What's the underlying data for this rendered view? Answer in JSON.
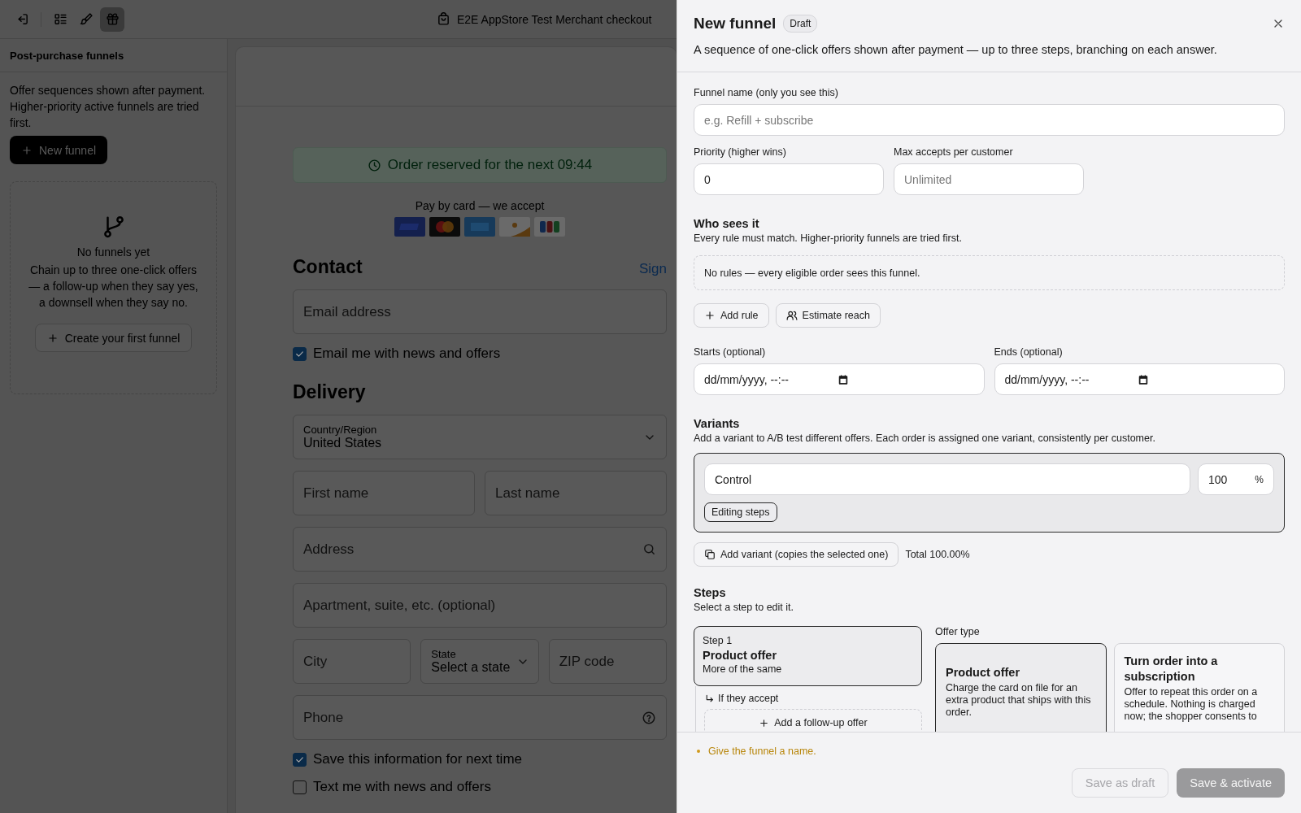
{
  "toolbar": {
    "items": [
      {
        "kind": "exit",
        "selected": false
      },
      {
        "kind": "list",
        "selected": false
      },
      {
        "kind": "brush",
        "selected": false
      },
      {
        "kind": "gift",
        "selected": true
      }
    ],
    "title": "E2E AppStore Test Merchant checkout"
  },
  "sidebar": {
    "heading": "Post-purchase funnels",
    "description": "Offer sequences shown after payment. Higher-priority active funnels are tried first.",
    "new_button": "New funnel",
    "empty": {
      "title": "No funnels yet",
      "text": "Chain up to three one-click offers — a follow-up when they say yes, a downsell when they say no.",
      "button": "Create your first funnel"
    }
  },
  "checkout": {
    "banner": "Order reserved for the next 09:44",
    "payment_note": "Pay by card — we accept",
    "cards": [
      {
        "kind": "visa"
      },
      {
        "kind": "mastercard"
      },
      {
        "kind": "amex"
      },
      {
        "kind": "discover"
      },
      {
        "kind": "jcb"
      }
    ],
    "contact": {
      "heading": "Contact",
      "link": "Sign",
      "email_placeholder": "Email address",
      "news": {
        "label": "Email me with news and offers",
        "checked": true
      }
    },
    "delivery": {
      "heading": "Delivery",
      "rows": [
        [
          {
            "kind": "select",
            "label": "Country/Region",
            "value": "United States"
          }
        ],
        [
          {
            "kind": "text",
            "placeholder": "First name"
          },
          {
            "kind": "text",
            "placeholder": "Last name"
          }
        ],
        [
          {
            "kind": "search",
            "placeholder": "Address"
          }
        ],
        [
          {
            "kind": "text",
            "placeholder": "Apartment, suite, etc. (optional)"
          }
        ],
        [
          {
            "kind": "text",
            "placeholder": "City"
          },
          {
            "kind": "select",
            "label": "State",
            "value": "Select a state"
          },
          {
            "kind": "text",
            "placeholder": "ZIP code"
          }
        ],
        [
          {
            "kind": "help",
            "placeholder": "Phone"
          }
        ]
      ],
      "options": [
        {
          "label": "Save this information for next time",
          "checked": true
        },
        {
          "label": "Text me with news and offers",
          "checked": false
        }
      ]
    }
  },
  "drawer": {
    "title": "New funnel",
    "badge": "Draft",
    "subtitle": "A sequence of one-click offers shown after payment — up to three steps, branching on each answer.",
    "name_field": {
      "label": "Funnel name (only you see this)",
      "placeholder": "e.g. Refill + subscribe"
    },
    "priority": {
      "label": "Priority (higher wins)",
      "value": "0"
    },
    "max_accepts": {
      "label": "Max accepts per customer",
      "placeholder": "Unlimited"
    },
    "audience": {
      "heading": "Who sees it",
      "text": "Every rule must match. Higher-priority funnels are tried first.",
      "empty": "No rules — every eligible order sees this funnel.",
      "buttons": [
        {
          "kind": "add",
          "label": "Add rule"
        },
        {
          "kind": "people",
          "label": "Estimate reach"
        }
      ]
    },
    "schedule": [
      {
        "label": "Starts (optional)",
        "value": "dd/mm/yyyy, --:--"
      },
      {
        "label": "Ends (optional)",
        "value": "dd/mm/yyyy, --:--"
      }
    ],
    "variants": {
      "heading": "Variants",
      "text": "Add a variant to A/B test different offers. Each order is assigned one variant, consistently per customer.",
      "items": [
        {
          "name": "Control",
          "weight": "100",
          "unit": "%",
          "status": "Editing steps",
          "selected": true
        }
      ],
      "add_button": "Add variant (copies the selected one)",
      "total": "Total 100.00%"
    },
    "steps": {
      "heading": "Steps",
      "text": "Select a step to edit it.",
      "items": [
        {
          "number": "Step 1",
          "title": "Product offer",
          "subtitle": "More of the same",
          "selected": true,
          "branch": "If they accept",
          "add_button": "Add a follow-up offer"
        }
      ],
      "offer_type": {
        "label": "Offer type",
        "options": [
          {
            "title": "Product offer",
            "text": "Charge the card on file for an extra product that ships with this order.",
            "selected": true
          },
          {
            "title": "Turn order into a subscription",
            "text": "Offer to repeat this order on a schedule. Nothing is charged now; the shopper consents to",
            "selected": false
          }
        ]
      }
    },
    "footer": {
      "warnings": [
        "Give the funnel a name."
      ],
      "buttons": [
        {
          "kind": "secondary",
          "label": "Save as draft",
          "disabled": true
        },
        {
          "kind": "primary",
          "label": "Save & activate",
          "disabled": true
        }
      ]
    }
  }
}
